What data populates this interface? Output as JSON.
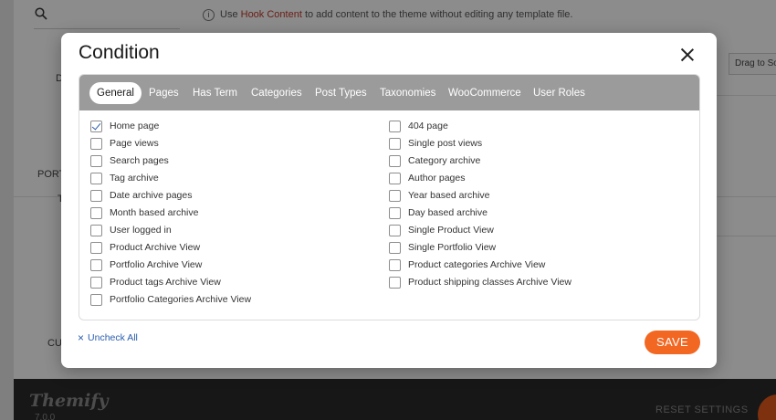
{
  "background": {
    "notice_prefix": "Use",
    "notice_link": "Hook Content",
    "notice_suffix": "to add content to the theme without editing any template file.",
    "drag_label": "Drag to So",
    "side_label_1": "D",
    "side_label_2": "PORT",
    "side_label_3": "T",
    "side_label_4": "CU",
    "logo": "Themify",
    "version": "7.0.0",
    "reset_label": "RESET SETTINGS",
    "info_icon": "i",
    "search_icon": "search-icon"
  },
  "modal": {
    "title": "Condition",
    "close_icon": "close-icon",
    "tabs": [
      {
        "label": "General",
        "active": true
      },
      {
        "label": "Pages",
        "active": false
      },
      {
        "label": "Has Term",
        "active": false
      },
      {
        "label": "Categories",
        "active": false
      },
      {
        "label": "Post Types",
        "active": false
      },
      {
        "label": "Taxonomies",
        "active": false
      },
      {
        "label": "WooCommerce",
        "active": false
      },
      {
        "label": "User Roles",
        "active": false
      }
    ],
    "left_options": [
      {
        "label": "Home page",
        "checked": true
      },
      {
        "label": "Page views",
        "checked": false
      },
      {
        "label": "Search pages",
        "checked": false
      },
      {
        "label": "Tag archive",
        "checked": false
      },
      {
        "label": "Date archive pages",
        "checked": false
      },
      {
        "label": "Month based archive",
        "checked": false
      },
      {
        "label": "User logged in",
        "checked": false
      },
      {
        "label": "Product Archive View",
        "checked": false
      },
      {
        "label": "Portfolio Archive View",
        "checked": false
      },
      {
        "label": "Product tags Archive View",
        "checked": false
      },
      {
        "label": "Portfolio Categories Archive View",
        "checked": false
      }
    ],
    "right_options": [
      {
        "label": "404 page",
        "checked": false
      },
      {
        "label": "Single post views",
        "checked": false
      },
      {
        "label": "Category archive",
        "checked": false
      },
      {
        "label": "Author pages",
        "checked": false
      },
      {
        "label": "Year based archive",
        "checked": false
      },
      {
        "label": "Day based archive",
        "checked": false
      },
      {
        "label": "Single Product View",
        "checked": false
      },
      {
        "label": "Single Portfolio View",
        "checked": false
      },
      {
        "label": "Product categories Archive View",
        "checked": false
      },
      {
        "label": "Product shipping classes Archive View",
        "checked": false
      }
    ],
    "uncheck_all_label": "Uncheck All",
    "uncheck_all_icon": "×",
    "save_label": "SAVE"
  },
  "colors": {
    "accent_save": "#f26722",
    "tabbar": "#9b9b9b",
    "link": "#2a5db0"
  }
}
